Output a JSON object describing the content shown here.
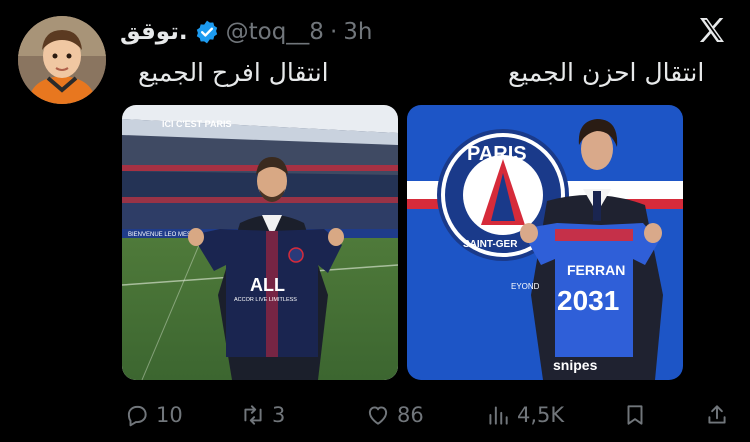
{
  "tweet": {
    "author_name": "توقق.",
    "handle": "@toq__8",
    "separator": "·",
    "time": "3h",
    "caption_left": "انتقال افرح الجميع",
    "caption_right": "انتقال احزن الجميع"
  },
  "images": {
    "left": {
      "banner": "ICI C'EST PARIS",
      "board": "BIENVENUE LEO MESSI",
      "sponsor": "ALL",
      "sponsor_sub": "ACCOR LIVE LIMITLESS"
    },
    "right": {
      "crest_top": "PARIS",
      "crest_bottom": "SAINT-GER",
      "shirt_name": "FERRAN",
      "shirt_number": "2031",
      "shirt_brand": "snipes",
      "sleeve_text": "EYOND"
    }
  },
  "actions": {
    "replies": "10",
    "reposts": "3",
    "likes": "86",
    "views": "4,5K"
  },
  "colors": {
    "background": "#000000",
    "text": "#e7e9ea",
    "muted": "#71767b",
    "verified": "#1d9bf0",
    "psg_blue": "#2b4aa8",
    "psg_red": "#d62b3a"
  }
}
